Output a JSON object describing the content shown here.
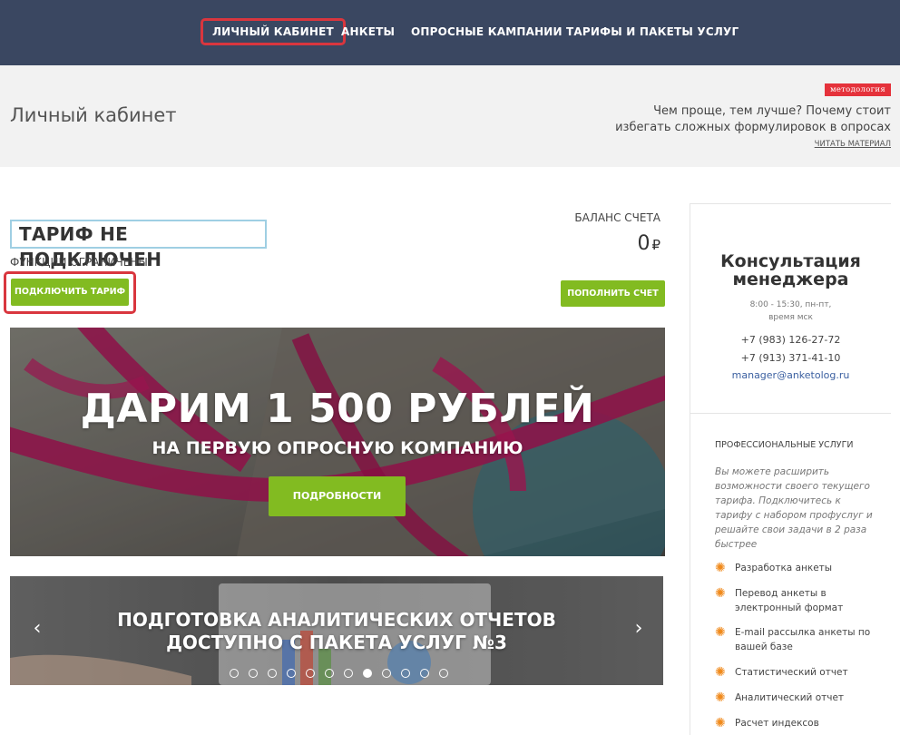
{
  "nav": {
    "items": [
      {
        "label": "ЛИЧНЫЙ КАБИНЕТ",
        "active": true
      },
      {
        "label": "АНКЕТЫ"
      },
      {
        "label": "ОПРОСНЫЕ КАМПАНИИ"
      },
      {
        "label": "ТАРИФЫ И ПАКЕТЫ УСЛУГ"
      }
    ]
  },
  "header": {
    "title": "Личный кабинет",
    "tag": "методология",
    "promo_line1": "Чем проще, тем лучше? Почему стоит",
    "promo_line2": "избегать сложных формулировок в опросах",
    "promo_link": "ЧИТАТЬ МАТЕРИАЛ"
  },
  "account": {
    "tariff_status": "ТАРИФ НЕ ПОДКЛЮЧЕН",
    "functions_note": "ФУНКЦИИ ОГРАНИЧЕНЫ",
    "connect_button": "ПОДКЛЮЧИТЬ ТАРИФ",
    "balance_label": "БАЛАНС СЧЕТА",
    "balance_value": "0",
    "currency": "₽",
    "topup_button": "ПОПОЛНИТЬ СЧЕТ"
  },
  "banner_gift": {
    "headline": "ДАРИМ 1 500 РУБЛЕЙ",
    "subheadline": "НА ПЕРВУЮ ОПРОСНУЮ КОМПАНИЮ",
    "button": "ПОДРОБНОСТИ"
  },
  "carousel": {
    "line1": "ПОДГОТОВКА АНАЛИТИЧЕСКИХ ОТЧЕТОВ",
    "line2": "ДОСТУПНО С ПАКЕТА УСЛУГ №3",
    "prev": "‹",
    "next": "›",
    "slide_count": 12,
    "active_slide": 8
  },
  "sidebar": {
    "consult_title_line1": "Консультация",
    "consult_title_line2": "менеджера",
    "hours_line1": "8:00 - 15:30, пн-пт,",
    "hours_line2": "время мск",
    "phone1": "+7 (983) 126-27-72",
    "phone2": "+7 (913) 371-41-10",
    "email": "manager@anketolog.ru",
    "pro_title": "ПРОФЕССИОНАЛЬНЫЕ УСЛУГИ",
    "pro_desc": "Вы можете расширить возможности своего текущего тарифа. Подключитесь к тарифу с набором профуслуг и решайте свои задачи в 2 раза быстрее",
    "services": [
      "Разработка анкеты",
      "Перевод анкеты в электронный формат",
      "E-mail рассылка анкеты по вашей базе",
      "Статистический отчет",
      "Аналитический отчет",
      "Расчет индексов"
    ]
  },
  "colors": {
    "nav_bg": "#3a4761",
    "accent_green": "#82bb21",
    "highlight_red": "#d9363e",
    "tag_red": "#e5323b",
    "gear_orange": "#f08a1c"
  }
}
